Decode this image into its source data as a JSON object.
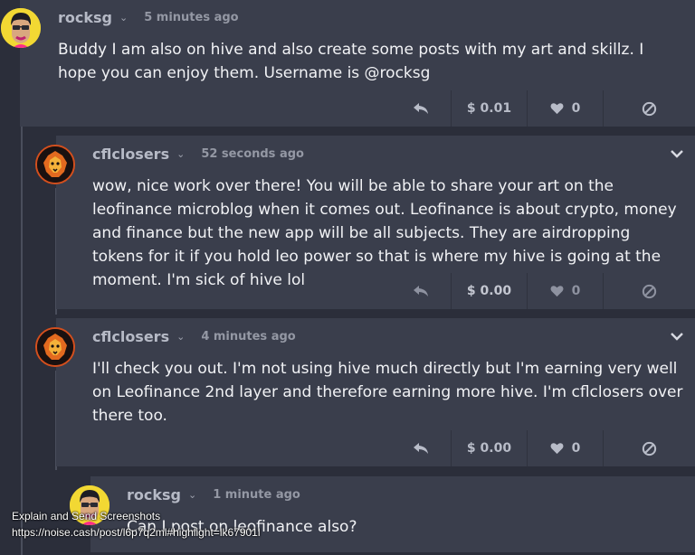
{
  "comments": [
    {
      "username": "rocksg",
      "caret": "⌄",
      "timestamp": "5 minutes ago",
      "body": "Buddy I am also on hive and also create some posts with my art and skillz. I hope you can enjoy them. Username is @rocksg",
      "payout": "$ 0.01",
      "likes": "0",
      "avatar_icon": "cartoon-face-icon"
    },
    {
      "username": "cflclosers",
      "caret": "⌄",
      "timestamp": "52 seconds ago",
      "body": "wow, nice work over there! You will be able to share your art on the leofinance microblog when it comes out. Leofinance is about crypto, money and finance but the new app will be all subjects. They are airdropping tokens for it if you hold leo power so that is where my hive is going at the moment. I'm sick of hive lol",
      "payout": "$ 0.00",
      "likes": "0",
      "avatar_icon": "lion-logo-icon"
    },
    {
      "username": "cflclosers",
      "caret": "⌄",
      "timestamp": "4 minutes ago",
      "body": "I'll check you out. I'm not using hive much directly but I'm earning very well on Leofinance 2nd layer and therefore earning more hive. I'm cflclosers over there too.",
      "payout": "$ 0.00",
      "likes": "0",
      "avatar_icon": "lion-logo-icon"
    },
    {
      "username": "rocksg",
      "caret": "⌄",
      "timestamp": "1 minute ago",
      "body": "Can I post on leofinance also?",
      "avatar_icon": "cartoon-face-icon"
    }
  ],
  "watermark": {
    "line1": "Explain and Send Screenshots",
    "line2": "https://noise.cash/post/l6p7q2ml#highlight=lk67901l"
  },
  "colors": {
    "background": "#2b2e3a",
    "card": "#3a3e4c",
    "text": "#f1f2f5",
    "muted": "#9498a4",
    "lion_border": "#d44f1d"
  }
}
